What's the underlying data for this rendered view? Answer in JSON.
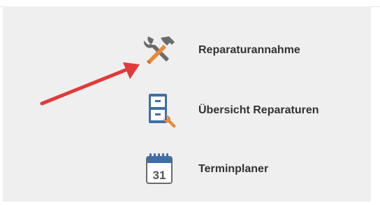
{
  "menu": {
    "items": [
      {
        "label": "Reparaturannahme",
        "icon": "tools-icon"
      },
      {
        "label": "Übersicht Reparaturen",
        "icon": "cabinet-wrench-icon"
      },
      {
        "label": "Terminplaner",
        "icon": "calendar-icon"
      }
    ],
    "calendar_day": "31"
  },
  "colors": {
    "panel_bg": "#efefef",
    "text": "#333333",
    "arrow": "#e23a3a",
    "icon_gray": "#6b6b6b",
    "icon_orange": "#e8893a",
    "icon_blue": "#3f6da8"
  }
}
